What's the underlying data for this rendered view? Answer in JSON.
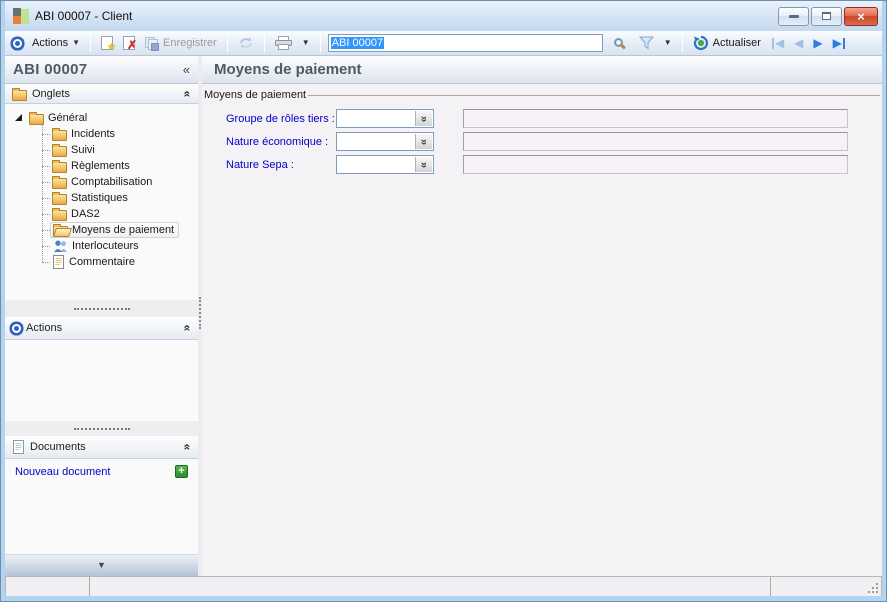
{
  "window": {
    "title": "ABI 00007 -  Client"
  },
  "glyphs": {
    "close": "×",
    "collapse_double_chevron": "«",
    "caret_down": "▼",
    "combo_chevron": "«",
    "nav_prev": "◀",
    "nav_next": "▶",
    "star": "★",
    "red_x": "✗",
    "plus": "+"
  },
  "toolbar": {
    "actions_label": "Actions",
    "save_label": "Enregistrer",
    "refresh_label": "Actualiser",
    "record_input": {
      "value": "ABI 00007"
    }
  },
  "sidebar": {
    "header": "ABI 00007",
    "panels": {
      "onglets": {
        "title": "Onglets"
      },
      "actions": {
        "title": "Actions"
      },
      "documents": {
        "title": "Documents",
        "new_document_label": "Nouveau document"
      }
    },
    "tree": {
      "root": {
        "label": "Général"
      },
      "items": [
        {
          "label": "Incidents",
          "icon": "folder-closed"
        },
        {
          "label": "Suivi",
          "icon": "folder-closed"
        },
        {
          "label": "Règlements",
          "icon": "folder-closed"
        },
        {
          "label": "Comptabilisation",
          "icon": "folder-closed"
        },
        {
          "label": "Statistiques",
          "icon": "folder-closed"
        },
        {
          "label": "DAS2",
          "icon": "folder-closed"
        },
        {
          "label": "Moyens de paiement",
          "icon": "folder-open",
          "selected": true
        },
        {
          "label": "Interlocuteurs",
          "icon": "people"
        },
        {
          "label": "Commentaire",
          "icon": "note"
        }
      ]
    }
  },
  "main": {
    "title": "Moyens de paiement",
    "groupbox_label": "Moyens de paiement",
    "fields": [
      {
        "label": "Groupe de rôles tiers :",
        "value": ""
      },
      {
        "label": "Nature économique :",
        "value": ""
      },
      {
        "label": "Nature Sepa :",
        "value": ""
      }
    ]
  },
  "colors": {
    "selection_blue": "#3297fd",
    "field_label_blue": "#0000c8",
    "link_blue": "#0000cc",
    "close_button_red": "#cc4526",
    "folder_yellow": "#eaa94a",
    "titlebar_blue": "#c3d8ef"
  }
}
